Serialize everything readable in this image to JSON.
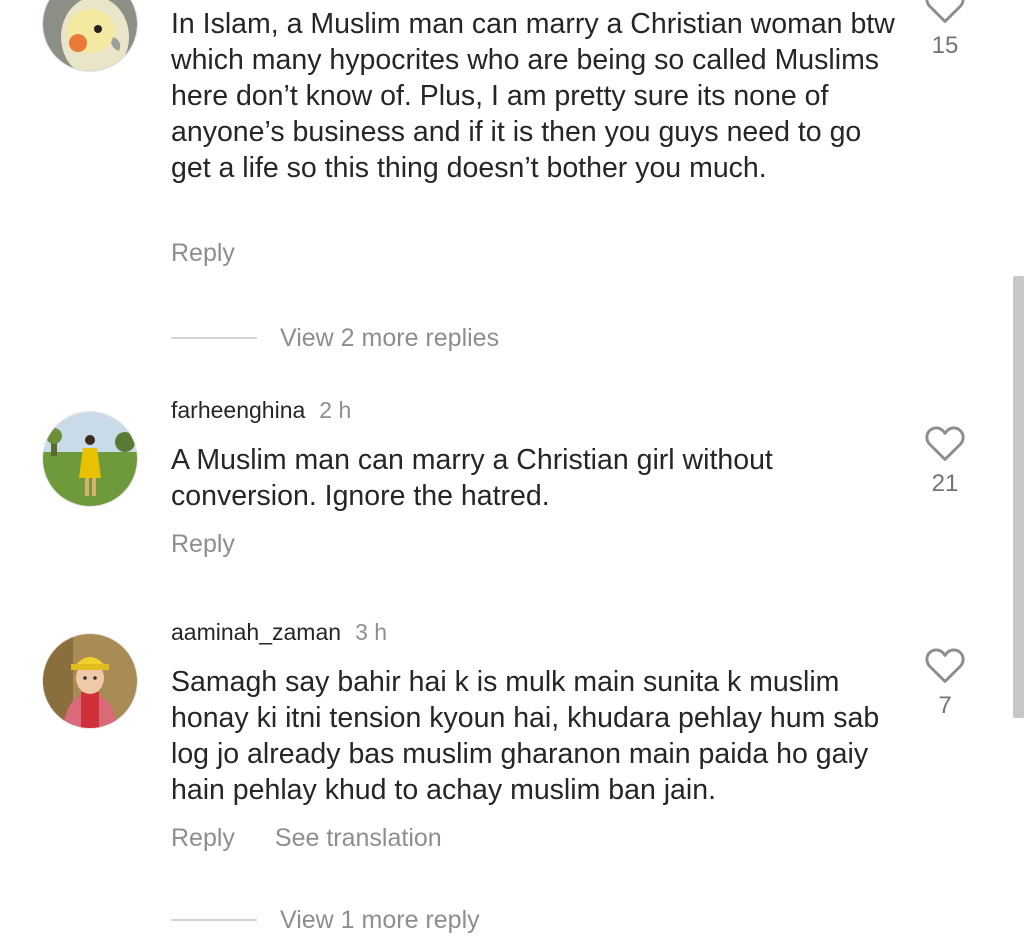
{
  "comments": [
    {
      "text": "In Islam, a Muslim man can marry a Christian woman btw which many hypocrites who are being so called Muslims here don’t know of. Plus, I am pretty sure its none of anyone’s business and if it is then you guys need to go get a life so this thing doesn’t bother you much.",
      "reply_label": "Reply",
      "like_count": "15",
      "avatar_icon": "cockatiel-avatar"
    },
    {
      "username": "farheenghina",
      "time": "2 h",
      "text": "A Muslim man can marry a Christian girl without conversion. Ignore the hatred.",
      "reply_label": "Reply",
      "like_count": "21",
      "avatar_icon": "user-photo-park-avatar"
    },
    {
      "username": "aaminah_zaman",
      "time": "3 h",
      "text": "Samagh say bahir hai k is mulk main sunita k muslim honay ki itni tension kyoun hai, khudara pehlay hum sab log jo already bas muslim gharanon main paida ho gaiy hain pehlay khud to achay muslim ban jain.",
      "reply_label": "Reply",
      "translate_label": "See translation",
      "like_count": "7",
      "avatar_icon": "user-photo-yellow-cap-avatar"
    }
  ],
  "view_more_replies": "View 2 more replies",
  "view_more_reply_partial": "View 1 more reply",
  "colors": {
    "text": "#262626",
    "secondary": "#8e8e8e",
    "divider": "#d4d4d4"
  }
}
